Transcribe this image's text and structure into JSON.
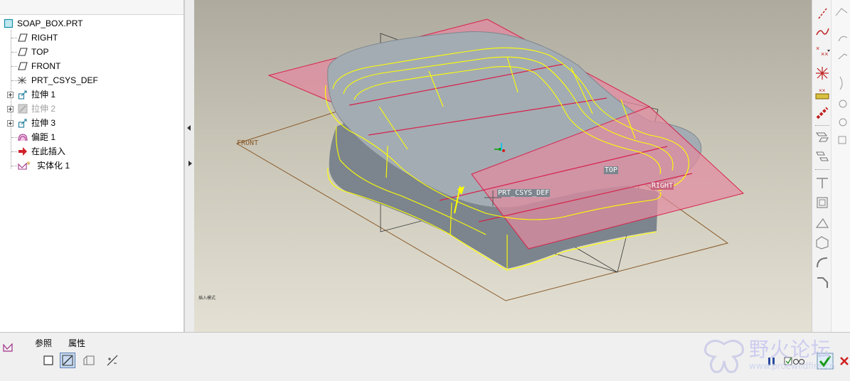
{
  "model_tree": {
    "root_label": "SOAP_BOX.PRT",
    "items": [
      {
        "label": "RIGHT",
        "icon": "datum-plane-icon",
        "expandable": false,
        "disabled": false
      },
      {
        "label": "TOP",
        "icon": "datum-plane-icon",
        "expandable": false,
        "disabled": false
      },
      {
        "label": "FRONT",
        "icon": "datum-plane-icon",
        "expandable": false,
        "disabled": false
      },
      {
        "label": "PRT_CSYS_DEF",
        "icon": "coordinate-system-icon",
        "expandable": false,
        "disabled": false
      },
      {
        "label": "拉伸 1",
        "icon": "extrude-icon",
        "expandable": true,
        "disabled": false
      },
      {
        "label": "拉伸 2",
        "icon": "extrude-icon",
        "expandable": true,
        "disabled": true
      },
      {
        "label": "拉伸 3",
        "icon": "extrude-icon",
        "expandable": true,
        "disabled": false
      },
      {
        "label": "偏距 1",
        "icon": "offset-icon",
        "expandable": false,
        "disabled": false
      },
      {
        "label": "在此插入",
        "icon": "insert-here-arrow-icon",
        "expandable": false,
        "disabled": false
      },
      {
        "label": "实体化 1",
        "icon": "solidify-icon",
        "expandable": false,
        "disabled": false
      }
    ]
  },
  "viewport": {
    "labels": {
      "front": "FRONT",
      "top": "TOP",
      "right": "RIGHT",
      "csys": "PRT_CSYS_DEF"
    },
    "status_text": "插入模式"
  },
  "colors": {
    "plane_fill": "#e28aa0",
    "plane_edge": "#d8204a",
    "solid": "#8f979f",
    "highlight": "#ffff00",
    "datum_line": "#8a5a2a",
    "sketch_line": "#202020"
  },
  "dashboard": {
    "tabs": {
      "references": "参照",
      "properties": "属性"
    },
    "feature_icon": "solidify-icon",
    "option_buttons": [
      "solid-fill-icon",
      "remove-material-icon",
      "replace-surface-icon",
      "flip-direction-icon"
    ]
  },
  "watermark": {
    "title": "野火论坛",
    "url": "www.proewildfire.cn"
  }
}
